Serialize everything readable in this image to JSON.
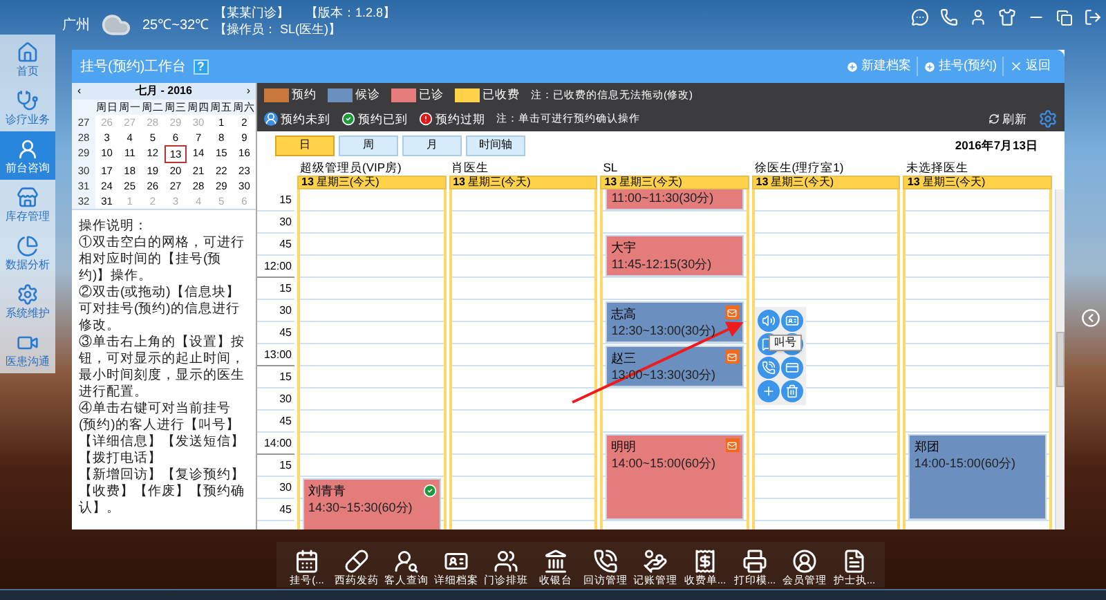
{
  "top_bar": {
    "city": "广州",
    "temperature": "25℃~32℃",
    "clinic": "【某某门诊】",
    "version": "【版本：1.2.8】",
    "operator": "【操作员： SL(医生)】"
  },
  "sidebar": {
    "items": [
      {
        "label": "首页",
        "kind": "home",
        "selected": false
      },
      {
        "label": "诊疗业务",
        "kind": "doctor",
        "selected": false
      },
      {
        "label": "前台咨询",
        "kind": "reception",
        "selected": true
      },
      {
        "label": "库存管理",
        "kind": "store",
        "selected": false
      },
      {
        "label": "数据分析",
        "kind": "chart",
        "selected": false
      },
      {
        "label": "系统维护",
        "kind": "settings",
        "selected": false
      },
      {
        "label": "医患沟通",
        "kind": "video",
        "selected": false
      }
    ]
  },
  "window": {
    "title": "挂号(预约)工作台",
    "help": "?",
    "actions": [
      {
        "label": "新建档案",
        "kind": "add"
      },
      {
        "label": "挂号(预约)",
        "kind": "add"
      },
      {
        "label": "返回",
        "kind": "close"
      }
    ]
  },
  "calendar": {
    "prev": "‹",
    "month": "七月 - 2016",
    "next": "›",
    "weekdays": [
      "周日",
      "周一",
      "周二",
      "周三",
      "周四",
      "周五",
      "周六"
    ],
    "weeks": [
      {
        "number": "27",
        "days": [
          {
            "label": "26",
            "muted": true,
            "selected": false
          },
          {
            "label": "27",
            "muted": true,
            "selected": false
          },
          {
            "label": "28",
            "muted": true,
            "selected": false
          },
          {
            "label": "29",
            "muted": true,
            "selected": false
          },
          {
            "label": "30",
            "muted": true,
            "selected": false
          },
          {
            "label": "1",
            "muted": false,
            "selected": false
          },
          {
            "label": "2",
            "muted": false,
            "selected": false
          }
        ]
      },
      {
        "number": "28",
        "days": [
          {
            "label": "3",
            "muted": false,
            "selected": false
          },
          {
            "label": "4",
            "muted": false,
            "selected": false
          },
          {
            "label": "5",
            "muted": false,
            "selected": false
          },
          {
            "label": "6",
            "muted": false,
            "selected": false
          },
          {
            "label": "7",
            "muted": false,
            "selected": false
          },
          {
            "label": "8",
            "muted": false,
            "selected": false
          },
          {
            "label": "9",
            "muted": false,
            "selected": false
          }
        ]
      },
      {
        "number": "29",
        "days": [
          {
            "label": "10",
            "muted": false,
            "selected": false
          },
          {
            "label": "11",
            "muted": false,
            "selected": false
          },
          {
            "label": "12",
            "muted": false,
            "selected": false
          },
          {
            "label": "13",
            "muted": false,
            "selected": true
          },
          {
            "label": "14",
            "muted": false,
            "selected": false
          },
          {
            "label": "15",
            "muted": false,
            "selected": false
          },
          {
            "label": "16",
            "muted": false,
            "selected": false
          }
        ]
      },
      {
        "number": "30",
        "days": [
          {
            "label": "17",
            "muted": false,
            "selected": false
          },
          {
            "label": "18",
            "muted": false,
            "selected": false
          },
          {
            "label": "19",
            "muted": false,
            "selected": false
          },
          {
            "label": "20",
            "muted": false,
            "selected": false
          },
          {
            "label": "21",
            "muted": false,
            "selected": false
          },
          {
            "label": "22",
            "muted": false,
            "selected": false
          },
          {
            "label": "23",
            "muted": false,
            "selected": false
          }
        ]
      },
      {
        "number": "31",
        "days": [
          {
            "label": "24",
            "muted": false,
            "selected": false
          },
          {
            "label": "25",
            "muted": false,
            "selected": false
          },
          {
            "label": "26",
            "muted": false,
            "selected": false
          },
          {
            "label": "27",
            "muted": false,
            "selected": false
          },
          {
            "label": "28",
            "muted": false,
            "selected": false
          },
          {
            "label": "29",
            "muted": false,
            "selected": false
          },
          {
            "label": "30",
            "muted": false,
            "selected": false
          }
        ]
      },
      {
        "number": "32",
        "days": [
          {
            "label": "31",
            "muted": false,
            "selected": false
          },
          {
            "label": "1",
            "muted": true,
            "selected": false
          },
          {
            "label": "2",
            "muted": true,
            "selected": false
          },
          {
            "label": "3",
            "muted": true,
            "selected": false
          },
          {
            "label": "4",
            "muted": true,
            "selected": false
          },
          {
            "label": "5",
            "muted": true,
            "selected": false
          },
          {
            "label": "6",
            "muted": true,
            "selected": false
          }
        ]
      }
    ]
  },
  "instructions": [
    "操作说明：",
    "①双击空白的网格，可进行相对应时间的【挂号(预约)】操作。",
    "②双击(或拖动)【信息块】可对挂号(预约)的信息进行修改。",
    "③单击右上角的【设置】按钮，可对显示的起止时间，最小时间刻度，显示的医生进行配置。",
    "④单击右键可对当前挂号(预约)的客人进行【叫号】【详细信息】【发送短信】【拨打电话】",
    "【新增回访】【复诊预约】",
    "【收费】【作废】【预约确认】。"
  ],
  "legend": [
    {
      "label": "预约",
      "color": "#c8783a"
    },
    {
      "label": "候诊",
      "color": "#6b8fbe"
    },
    {
      "label": "已诊",
      "color": "#e57c7c"
    },
    {
      "label": "已收费",
      "color": "#ffd24a"
    }
  ],
  "legend_note": "注：已收费的信息无法拖动(修改)",
  "markers": [
    {
      "label": "预约未到",
      "kind": "not-arrived"
    },
    {
      "label": "预约已到",
      "kind": "arrived"
    },
    {
      "label": "预约过期",
      "kind": "expired"
    }
  ],
  "marker_note": "注：单击可进行预约确认操作",
  "refresh": "刷新",
  "views": [
    {
      "label": "日",
      "selected": true
    },
    {
      "label": "周",
      "selected": false
    },
    {
      "label": "月",
      "selected": false
    },
    {
      "label": "时间轴",
      "selected": false
    }
  ],
  "date": "2016年7月13日",
  "time_labels": [
    "15",
    "30",
    "45",
    "12:00",
    "15",
    "30",
    "45",
    "13:00",
    "15",
    "30",
    "45",
    "14:00",
    "15",
    "30",
    "45"
  ],
  "columns": [
    {
      "doctor": "超级管理员(VIP房)",
      "day": "13",
      "weekday": "星期三(今天)",
      "appointments": [
        {
          "name": "刘青青",
          "time": "14:30~15:30(60分)",
          "color": "#e57c7c",
          "flagged": false,
          "confirmed": true
        }
      ]
    },
    {
      "doctor": "肖医生",
      "day": "13",
      "weekday": "星期三(今天)"
    },
    {
      "doctor": "SL",
      "day": "13",
      "weekday": "星期三(今天)",
      "appointments": [
        {
          "time": "11:00~11:30(30分)",
          "color": "#e57c7c",
          "flagged": false,
          "confirmed": false
        },
        {
          "name": "大宇",
          "time": "11:45-12:15(30分)",
          "color": "#e57c7c",
          "flagged": false,
          "confirmed": false
        },
        {
          "name": "志高",
          "time": "12:30~13:00(30分)",
          "color": "#6b8fbe",
          "flagged": true,
          "confirmed": false
        },
        {
          "name": "赵三",
          "time": "13:00~13:30(30分)",
          "color": "#6b8fbe",
          "flagged": true,
          "confirmed": false
        },
        {
          "name": "明明",
          "time": "14:00~15:00(60分)",
          "color": "#e57c7c",
          "flagged": true,
          "confirmed": false
        }
      ]
    },
    {
      "doctor": "徐医生(理疗室1)",
      "day": "13",
      "weekday": "星期三(今天)"
    },
    {
      "doctor": "未选择医生",
      "day": "13",
      "weekday": "星期三(今天)",
      "appointments": [
        {
          "name": "郑团",
          "time": "14:00-15:00(60分)",
          "color": "#6b8fbe",
          "flagged": false,
          "confirmed": false
        }
      ]
    }
  ],
  "context_menu": {
    "tooltip": "叫号",
    "actions": [
      {
        "kind": "call"
      },
      {
        "kind": "detail"
      },
      {
        "kind": "sms"
      },
      {
        "kind": "info"
      },
      {
        "kind": "phone"
      },
      {
        "kind": "payment"
      },
      {
        "kind": "add"
      },
      {
        "kind": "delete"
      }
    ]
  },
  "dock": [
    {
      "label": "挂号(...",
      "kind": "register"
    },
    {
      "label": "西药发药",
      "kind": "medicine"
    },
    {
      "label": "客人查询",
      "kind": "search"
    },
    {
      "label": "详细档案",
      "kind": "card"
    },
    {
      "label": "门诊排班",
      "kind": "schedule"
    },
    {
      "label": "收银台",
      "kind": "cashier"
    },
    {
      "label": "回访管理",
      "kind": "phone"
    },
    {
      "label": "记账管理",
      "kind": "money"
    },
    {
      "label": "收费单...",
      "kind": "receipt"
    },
    {
      "label": "打印模...",
      "kind": "print"
    },
    {
      "label": "会员管理",
      "kind": "member"
    },
    {
      "label": "护士执...",
      "kind": "file"
    }
  ]
}
